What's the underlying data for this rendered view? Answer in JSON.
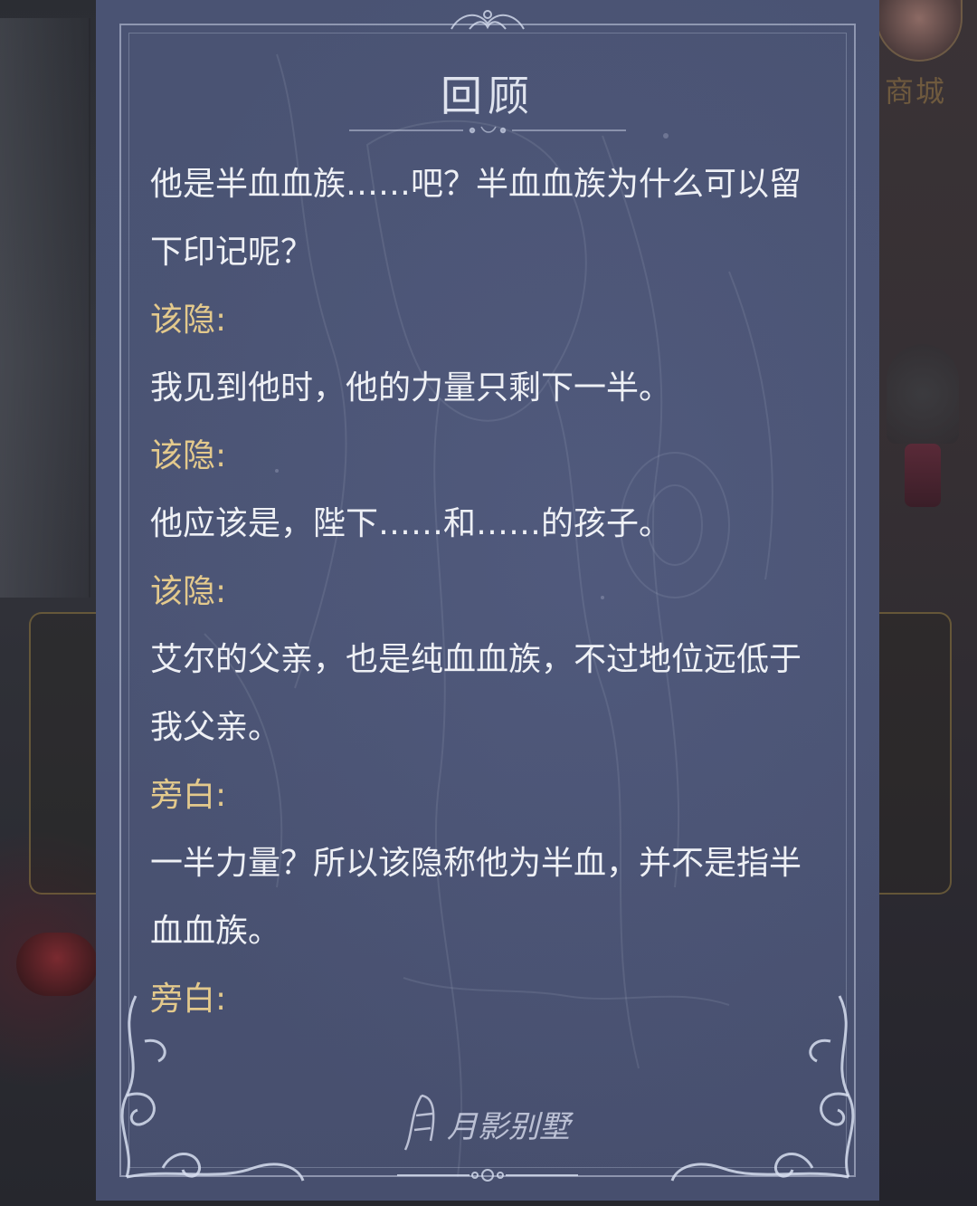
{
  "shop": {
    "label": "商城"
  },
  "review": {
    "title": "回顾",
    "entries": [
      {
        "type": "text",
        "text": "他是半血血族……吧？半血血族为什么可以留"
      },
      {
        "type": "text",
        "text": "下印记呢？"
      },
      {
        "type": "speaker",
        "text": "该隐:"
      },
      {
        "type": "text",
        "text": "我见到他时，他的力量只剩下一半。"
      },
      {
        "type": "speaker",
        "text": "该隐:"
      },
      {
        "type": "text",
        "text": "他应该是，陛下……和……的孩子。"
      },
      {
        "type": "speaker",
        "text": "该隐:"
      },
      {
        "type": "text",
        "text": "艾尔的父亲，也是纯血血族，不过地位远低于"
      },
      {
        "type": "text",
        "text": "我父亲。"
      },
      {
        "type": "speaker",
        "text": "旁白:"
      },
      {
        "type": "text",
        "text": "一半力量？所以该隐称他为半血，并不是指半"
      },
      {
        "type": "text",
        "text": "血血族。"
      },
      {
        "type": "speaker",
        "text": "旁白:"
      }
    ]
  },
  "logo": {
    "text": "月影别墅"
  },
  "colors": {
    "panel": "#4a5373",
    "speaker": "#e3c98c",
    "text": "#eef0f5"
  }
}
